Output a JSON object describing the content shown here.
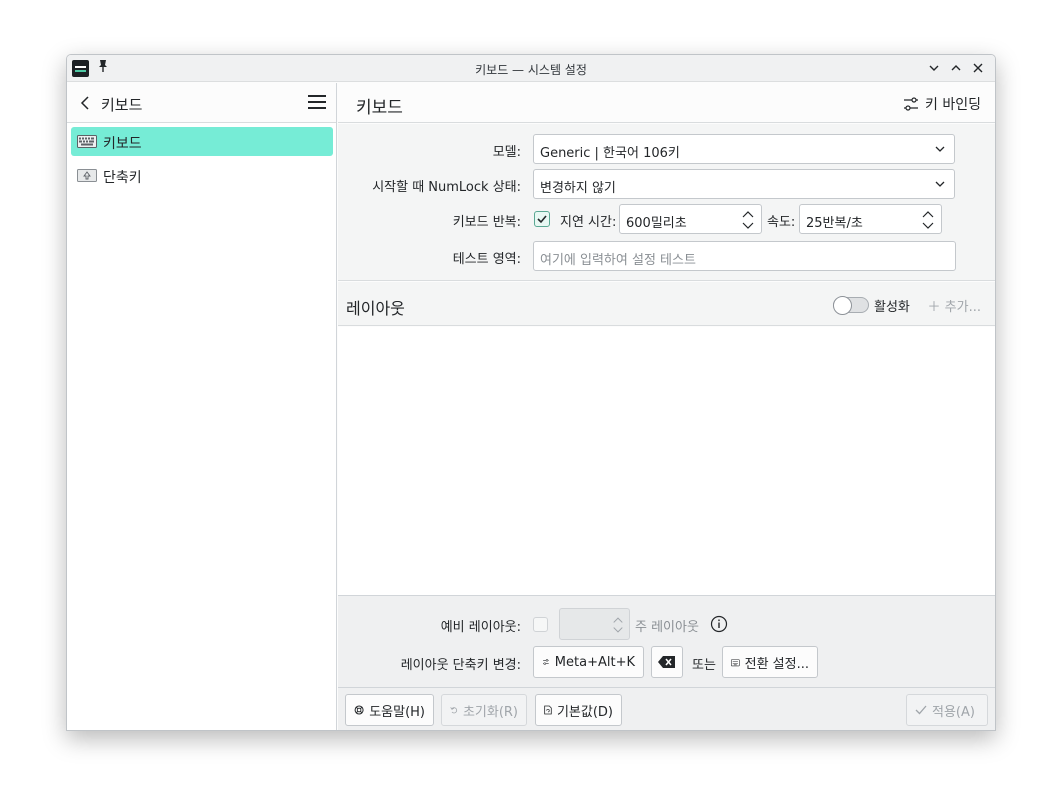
{
  "window": {
    "title": "키보드 — 시스템 설정"
  },
  "sidebar": {
    "title": "키보드",
    "items": [
      {
        "label": "키보드",
        "active": true,
        "icon": "keyboard-icon"
      },
      {
        "label": "단축키",
        "active": false,
        "icon": "shortcut-key-icon"
      }
    ]
  },
  "main": {
    "title": "키보드",
    "key_binding_label": "키 바인딩",
    "model": {
      "label": "모델:",
      "value": "Generic | 한국어 106키"
    },
    "numlock": {
      "label": "시작할 때 NumLock 상태:",
      "value": "변경하지 않기"
    },
    "repeat": {
      "label": "키보드 반복:",
      "checked": true,
      "delay_label": "지연 시간:",
      "delay_value": "600밀리초",
      "rate_label": "속도:",
      "rate_value": "25반복/초"
    },
    "test": {
      "label": "테스트 영역:",
      "placeholder": "여기에 입력하여 설정 테스트"
    }
  },
  "layout": {
    "title": "레이아웃",
    "enable_label": "활성화",
    "enabled": false,
    "add_label": "추가..."
  },
  "bottom": {
    "spare_label": "예비 레이아웃:",
    "main_layout_label": "주 레이아웃",
    "shortcut_label": "레이아웃 단축키 변경:",
    "shortcut_value": "Meta+Alt+K",
    "or_label": "또는",
    "switch_settings_label": "전환 설정..."
  },
  "footer": {
    "help_label": "도움말(H)",
    "reset_label": "초기화(R)",
    "defaults_label": "기본값(D)",
    "apply_label": "적용(A)"
  },
  "colors": {
    "accent": "#76ecd6",
    "accent_check": "#3daee9"
  }
}
